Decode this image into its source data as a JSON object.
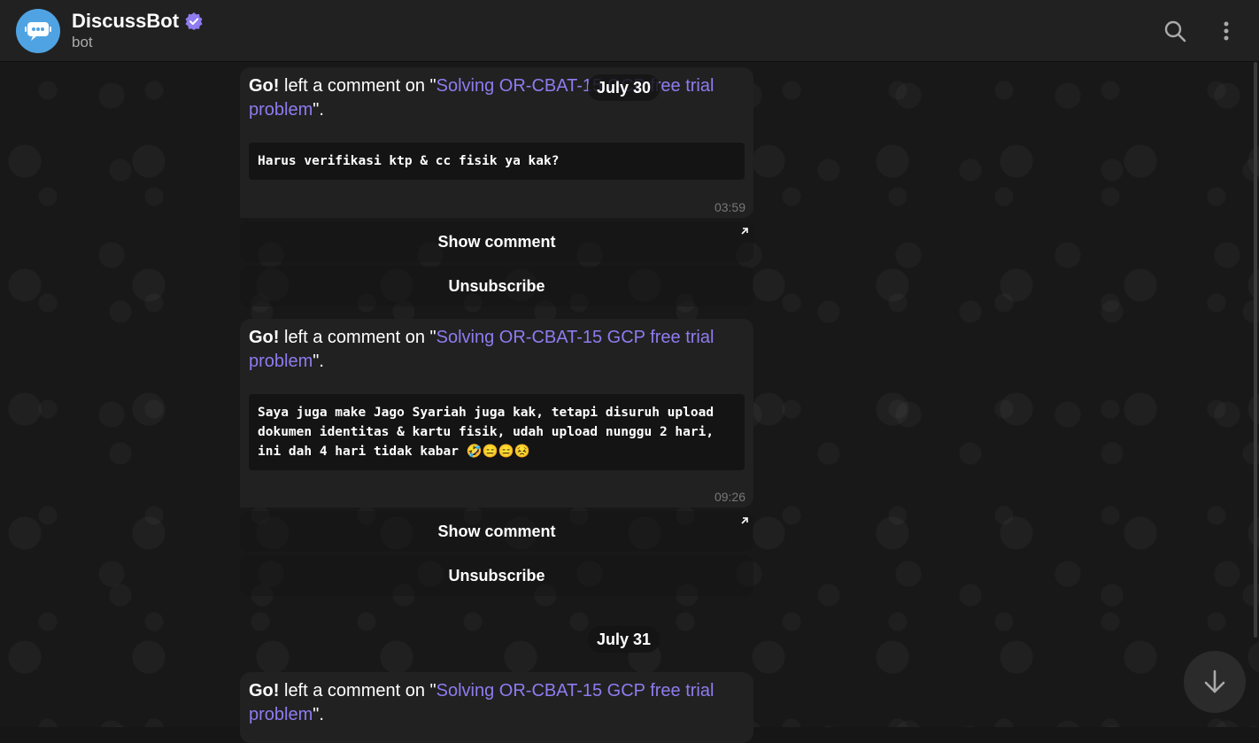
{
  "header": {
    "title": "DiscussBot",
    "subtitle": "bot",
    "verified_icon": "verified-badge-icon",
    "search_icon": "search-icon",
    "menu_icon": "more-vertical-icon"
  },
  "colors": {
    "accent_link": "#8e7cf0",
    "avatar_bg": "#4fa3e3",
    "bubble_bg": "#212121",
    "header_bg": "#212121"
  },
  "messages": [
    {
      "author": "Go!",
      "action": " left a comment on \"",
      "link_text": "Solving OR-CBAT-15 GCP free trial problem",
      "suffix": "\".",
      "comment": "Harus verifikasi ktp & cc fisik ya kak?",
      "time": "03:59",
      "show_button": "Show comment",
      "unsubscribe_button": "Unsubscribe"
    },
    {
      "author": "Go!",
      "action": " left a comment on \"",
      "link_text": "Solving OR-CBAT-15 GCP free trial problem",
      "suffix": "\".",
      "comment": "Saya juga make Jago Syariah juga kak, tetapi disuruh upload dokumen identitas & kartu fisik, udah upload nunggu 2 hari, ini dah 4 hari tidak kabar  🤣😑😑😣",
      "time": "09:26",
      "show_button": "Show comment",
      "unsubscribe_button": "Unsubscribe"
    },
    {
      "author": "Go!",
      "action": " left a comment on \"",
      "link_text": "Solving OR-CBAT-15 GCP free trial problem",
      "suffix": "\"."
    }
  ],
  "dates": [
    "July 30",
    "July 31"
  ],
  "scroll_down_icon": "arrow-down-icon"
}
